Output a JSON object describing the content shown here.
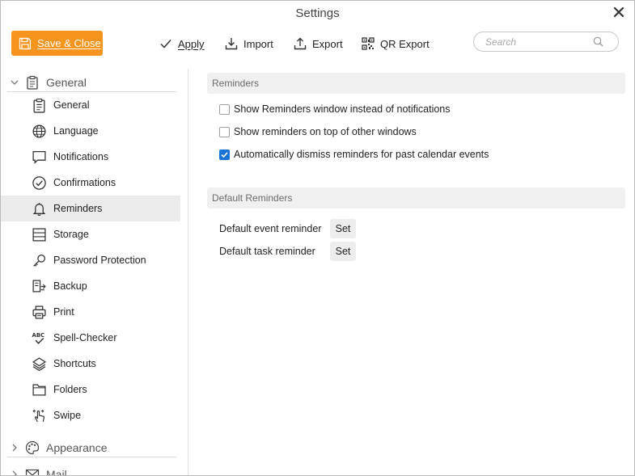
{
  "window": {
    "title": "Settings"
  },
  "toolbar": {
    "save_close": "Save & Close",
    "apply": "Apply",
    "import": "Import",
    "export": "Export",
    "qr_export": "QR Export",
    "search_placeholder": "Search",
    "accent_color": "#f7941d"
  },
  "sidebar": {
    "groups": [
      {
        "label": "General",
        "expanded": true,
        "icon": "clipboard-icon"
      },
      {
        "label": "Appearance",
        "expanded": false,
        "icon": "palette-icon"
      },
      {
        "label": "Mail",
        "expanded": false,
        "icon": "envelope-icon"
      }
    ],
    "items": [
      {
        "label": "General",
        "icon": "clipboard-icon"
      },
      {
        "label": "Language",
        "icon": "globe-icon"
      },
      {
        "label": "Notifications",
        "icon": "speech-bubble-icon"
      },
      {
        "label": "Confirmations",
        "icon": "check-circle-icon"
      },
      {
        "label": "Reminders",
        "icon": "bell-icon",
        "active": true
      },
      {
        "label": "Storage",
        "icon": "storage-icon"
      },
      {
        "label": "Password Protection",
        "icon": "key-icon"
      },
      {
        "label": "Backup",
        "icon": "backup-icon"
      },
      {
        "label": "Print",
        "icon": "printer-icon"
      },
      {
        "label": "Spell-Checker",
        "icon": "spell-check-icon"
      },
      {
        "label": "Shortcuts",
        "icon": "layers-icon"
      },
      {
        "label": "Folders",
        "icon": "folder-icon"
      },
      {
        "label": "Swipe",
        "icon": "swipe-hand-icon"
      }
    ]
  },
  "reminders": {
    "header": "Reminders",
    "options": [
      {
        "label": "Show Reminders window instead of notifications",
        "checked": false
      },
      {
        "label": "Show reminders on top of other windows",
        "checked": false
      },
      {
        "label": "Automatically dismiss reminders for past calendar events",
        "checked": true
      }
    ]
  },
  "default_reminders": {
    "header": "Default Reminders",
    "event_label": "Default event reminder",
    "task_label": "Default task reminder",
    "set_label": "Set"
  },
  "colors": {
    "checkbox_checked": "#1a73d9",
    "active_item_bg": "#ebebeb"
  }
}
